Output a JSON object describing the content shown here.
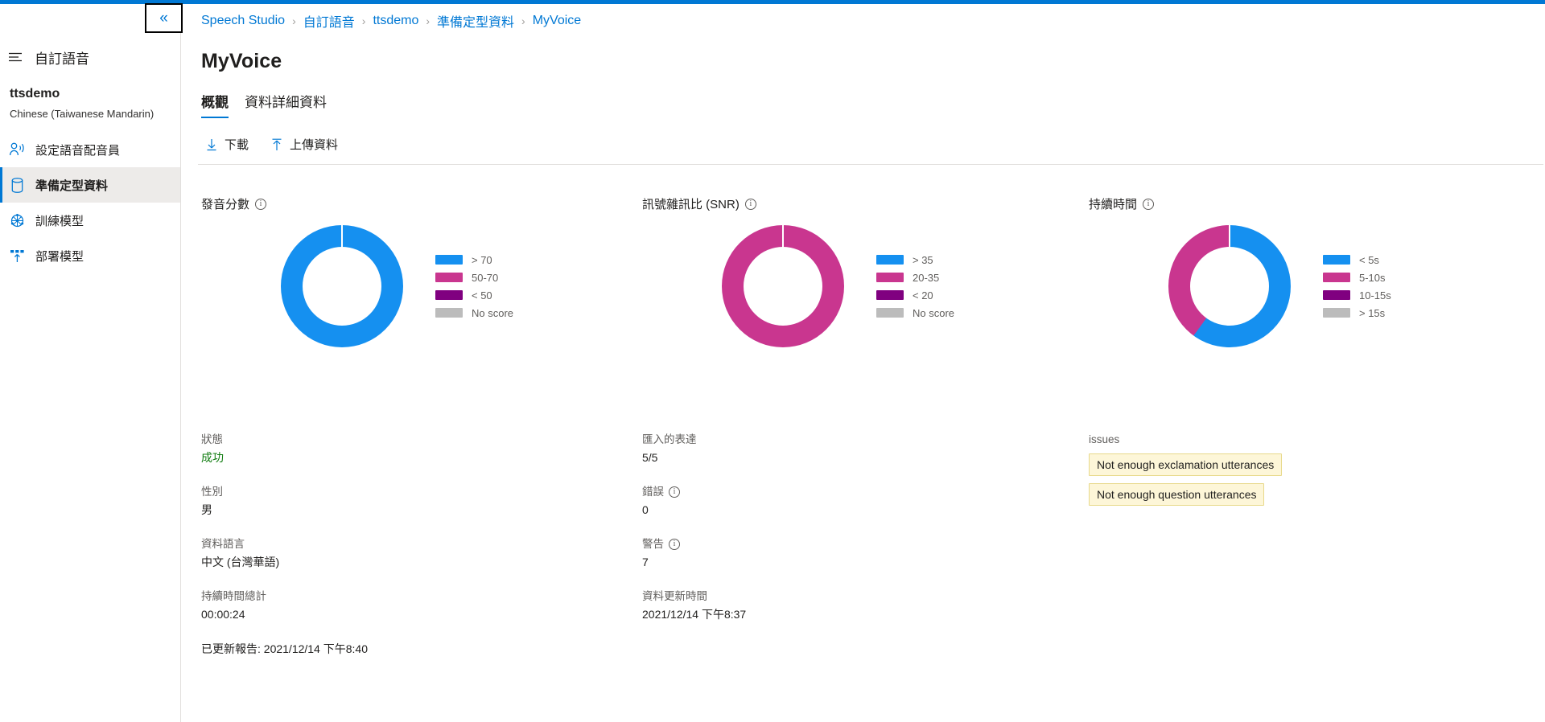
{
  "accent_color": "#0078d4",
  "topbar": {
    "collapse_label": "«"
  },
  "sidebar": {
    "rail_title": "自訂語音",
    "project_name": "ttsdemo",
    "project_language": "Chinese (Taiwanese Mandarin)",
    "items": [
      {
        "label": "設定語音配音員",
        "icon": "voice-talent-icon",
        "selected": false
      },
      {
        "label": "準備定型資料",
        "icon": "database-icon",
        "selected": true
      },
      {
        "label": "訓練模型",
        "icon": "train-model-icon",
        "selected": false
      },
      {
        "label": "部署模型",
        "icon": "deploy-model-icon",
        "selected": false
      }
    ]
  },
  "breadcrumb": {
    "separator": "›",
    "items": [
      "Speech Studio",
      "自訂語音",
      "ttsdemo",
      "準備定型資料",
      "MyVoice"
    ]
  },
  "page_title": "MyVoice",
  "tabs": [
    {
      "label": "概觀",
      "active": true
    },
    {
      "label": "資料詳細資料",
      "active": false
    }
  ],
  "toolbar": {
    "download_label": "下載",
    "upload_label": "上傳資料"
  },
  "chart_data": [
    {
      "type": "pie",
      "title": "發音分數",
      "categories": [
        "> 70",
        "50-70",
        "< 50",
        "No score"
      ],
      "values": [
        100,
        0,
        0,
        0
      ],
      "colors": [
        "#1590f0",
        "#c9368f",
        "#800080",
        "#bcbcbc"
      ],
      "legend": "right",
      "donut": true
    },
    {
      "type": "pie",
      "title": "訊號雜訊比 (SNR)",
      "categories": [
        "> 35",
        "20-35",
        "< 20",
        "No score"
      ],
      "values": [
        0,
        100,
        0,
        0
      ],
      "colors": [
        "#1590f0",
        "#c9368f",
        "#800080",
        "#bcbcbc"
      ],
      "legend": "right",
      "donut": true
    },
    {
      "type": "pie",
      "title": "持續時間",
      "categories": [
        "< 5s",
        "5-10s",
        "10-15s",
        "> 15s"
      ],
      "values": [
        60,
        40,
        0,
        0
      ],
      "colors": [
        "#1590f0",
        "#c9368f",
        "#800080",
        "#bcbcbc"
      ],
      "legend": "right",
      "donut": true
    }
  ],
  "details": {
    "col1": [
      {
        "label": "狀態",
        "value": "成功",
        "status": "success"
      },
      {
        "label": "性別",
        "value": "男"
      },
      {
        "label": "資料語言",
        "value": "中文 (台灣華語)"
      },
      {
        "label": "持續時間總計",
        "value": "00:00:24"
      }
    ],
    "report_updated": "已更新報告: 2021/12/14 下午8:40",
    "col2": [
      {
        "label": "匯入的表達",
        "value": "5/5",
        "info": false
      },
      {
        "label": "錯誤",
        "value": "0",
        "info": true
      },
      {
        "label": "警告",
        "value": "7",
        "info": true
      },
      {
        "label": "資料更新時間",
        "value": "2021/12/14 下午8:37",
        "info": false
      }
    ],
    "issues_label": "issues",
    "issues": [
      "Not enough exclamation utterances",
      "Not enough question utterances"
    ]
  }
}
